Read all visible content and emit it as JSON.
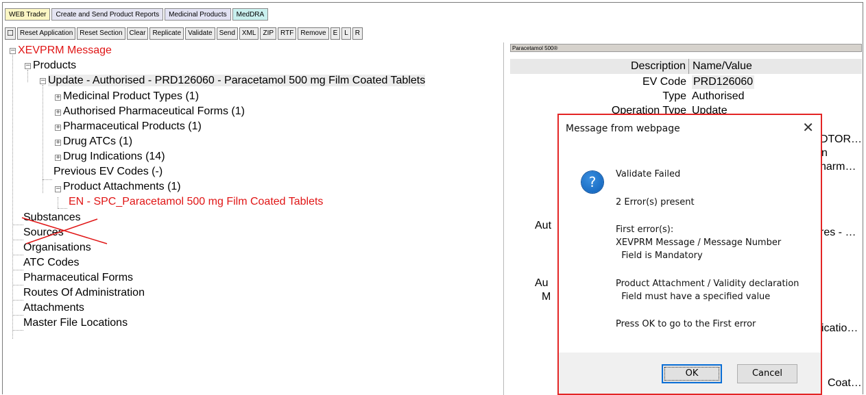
{
  "tabs": [
    "WEB Trader",
    "Create and Send Product Reports",
    "Medicinal Products",
    "MedDRA"
  ],
  "toolbar": {
    "square": "☐",
    "buttons": [
      "Reset Application",
      "Reset Section",
      "Clear",
      "Replicate",
      "Validate",
      "Send",
      "XML",
      "ZIP",
      "RTF",
      "Remove",
      "E",
      "L",
      "R"
    ]
  },
  "tree": {
    "root": "XEVPRM Message",
    "products": "Products",
    "update": "Update - Authorised - PRD126060 - Paracetamol 500 mg Film Coated Tablets",
    "children": [
      "Medicinal Product Types (1)",
      "Authorised Pharmaceutical Forms (1)",
      "Pharmaceutical Products (1)",
      "Drug ATCs (1)",
      "Drug Indications (14)",
      "Previous EV Codes (-)",
      "Product Attachments (1)"
    ],
    "attachment": "EN - SPC_Paracetamol 500 mg Film Coated Tablets",
    "sections": [
      "Substances",
      "Sources",
      "Organisations",
      "ATC Codes",
      "Pharmaceutical Forms",
      "Routes Of Administration",
      "Attachments",
      "Master File Locations"
    ]
  },
  "detail": {
    "title": "Paracetamol 500®",
    "header_desc": "Description",
    "header_val": "Name/Value",
    "rows": [
      {
        "desc": "EV Code",
        "val": "PRD126060"
      },
      {
        "desc": "Type",
        "val": "Authorised"
      },
      {
        "desc": "Operation Type",
        "val": "Update"
      }
    ],
    "fragments": [
      "DTOR…",
      "n",
      "harm…",
      "Aut",
      "res  - …",
      "Au",
      "M",
      "icatio…",
      "Coat…"
    ]
  },
  "dialog": {
    "title": "Message from webpage",
    "close": "✕",
    "icon": "?",
    "lines": [
      "Validate Failed",
      "2 Error(s) present",
      "First error(s):",
      "XEVPRM Message / Message Number",
      "  Field is Mandatory",
      "Product Attachment / Validity declaration",
      "  Field must have a specified value",
      "Press OK to go to the First error"
    ],
    "ok": "OK",
    "cancel": "Cancel"
  },
  "colors": {
    "accent_red": "#e01515",
    "dialog_border": "#e32424",
    "question_icon": "#0d5fb8"
  }
}
